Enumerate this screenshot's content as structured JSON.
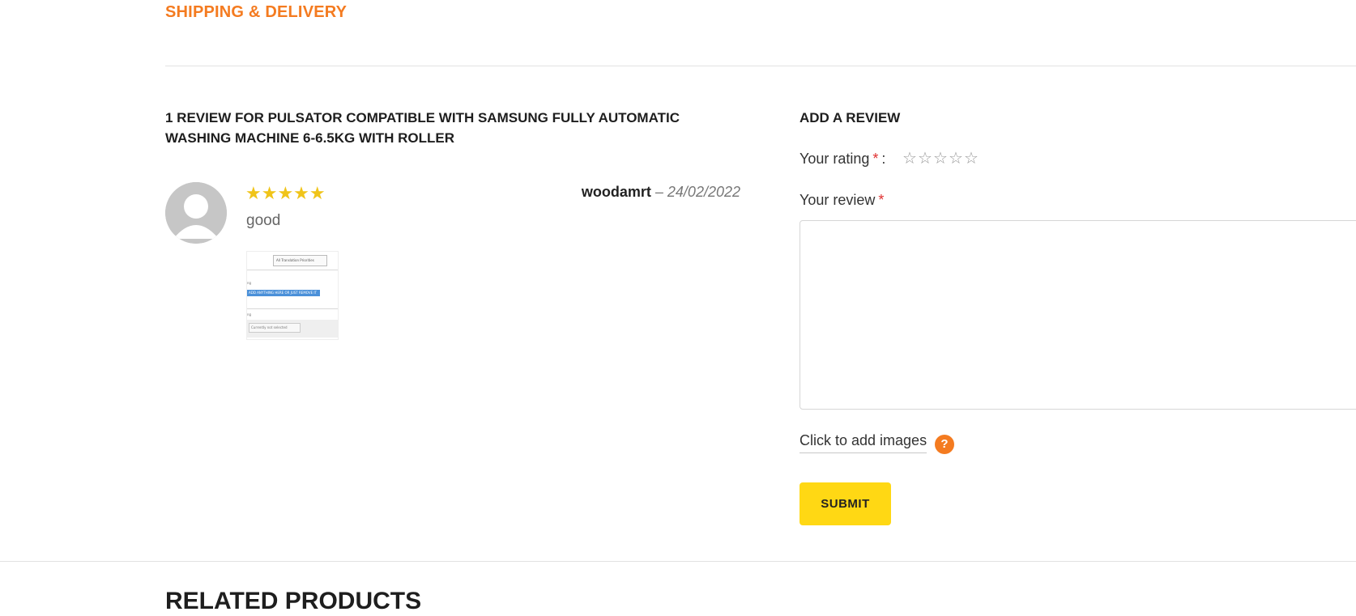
{
  "tabs": {
    "shipping_label": "SHIPPING & DELIVERY"
  },
  "reviews": {
    "title": "1 REVIEW FOR PULSATOR COMPATIBLE WITH SAMSUNG FULLY AUTOMATIC WASHING MACHINE 6-6.5KG WITH ROLLER",
    "items": [
      {
        "stars": "★★★★★",
        "rating": 5,
        "author": "woodamrt",
        "separator": "–",
        "date": "24/02/2022",
        "text": "good",
        "attachment": {
          "select_label": "All Translation Priorities",
          "highlight_text": "ADD ANYTHING HERE OR JUST REMOVE IT",
          "small_select": "Currently not selected"
        }
      }
    ]
  },
  "add_review": {
    "title": "ADD A REVIEW",
    "rating_label": "Your rating",
    "required_mark": "*",
    "colon": ":",
    "empty_star": "☆",
    "review_label": "Your review",
    "review_value": "",
    "add_images_label": "Click to add images",
    "help_glyph": "?",
    "submit_label": "SUBMIT"
  },
  "related": {
    "title": "RELATED PRODUCTS"
  },
  "colors": {
    "accent": "#f47b20",
    "star": "#f0c419",
    "submit": "#ffd814",
    "required": "#e03030"
  },
  "icons": {
    "avatar": "user-avatar-icon",
    "help": "question-icon",
    "star": "star-icon"
  }
}
